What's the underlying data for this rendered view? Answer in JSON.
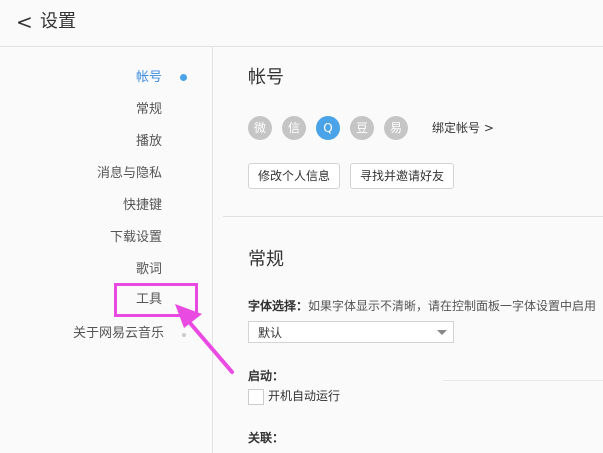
{
  "header": {
    "back_glyph": "<",
    "title": "设置"
  },
  "sidebar": {
    "items": [
      {
        "label": "帐号",
        "active": true
      },
      {
        "label": "常规"
      },
      {
        "label": "播放"
      },
      {
        "label": "消息与隐私"
      },
      {
        "label": "快捷键"
      },
      {
        "label": "下载设置"
      },
      {
        "label": "歌词"
      },
      {
        "label": "工具"
      },
      {
        "label": "关于网易云音乐"
      }
    ]
  },
  "account": {
    "title": "帐号",
    "socials": [
      {
        "name": "weibo-icon",
        "glyph": "微"
      },
      {
        "name": "wechat-icon",
        "glyph": "信"
      },
      {
        "name": "qq-icon",
        "glyph": "Q"
      },
      {
        "name": "douban-icon",
        "glyph": "豆"
      },
      {
        "name": "yixin-icon",
        "glyph": "易"
      }
    ],
    "bind_label": "绑定帐号 >",
    "edit_profile": "修改个人信息",
    "find_friends": "寻找并邀请好友"
  },
  "general": {
    "title": "常规",
    "font_label": "字体选择：",
    "font_hint": "如果字体显示不清晰，请在控制面板一字体设置中启用",
    "font_value": "默认",
    "startup_label": "启动：",
    "autostart_label": "开机自动运行",
    "assoc_label": "关联："
  },
  "colors": {
    "accent": "#3f8ce0",
    "annotation": "#e94be2"
  }
}
